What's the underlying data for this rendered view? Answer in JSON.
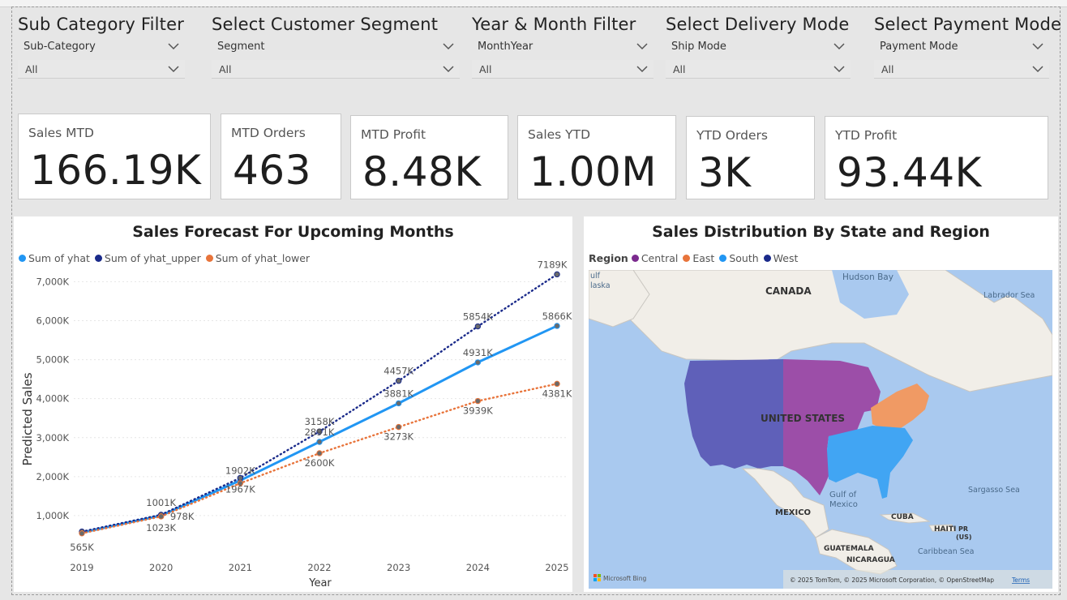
{
  "filters": [
    {
      "title": "Sub Category Filter",
      "field": "Sub-Category",
      "value": "All"
    },
    {
      "title": "Select Customer Segment",
      "field": "Segment",
      "value": "All"
    },
    {
      "title": "Year & Month Filter",
      "field": "MonthYear",
      "value": "All"
    },
    {
      "title": "Select Delivery Mode",
      "field": "Ship Mode",
      "value": "All"
    },
    {
      "title": "Select Payment Mode",
      "field": "Payment Mode",
      "value": "All"
    }
  ],
  "cards": [
    {
      "label": "Sales MTD",
      "value": "166.19K"
    },
    {
      "label": "MTD Orders",
      "value": "463"
    },
    {
      "label": "MTD Profit",
      "value": "8.48K"
    },
    {
      "label": "Sales YTD",
      "value": "1.00M"
    },
    {
      "label": "YTD Orders",
      "value": "3K"
    },
    {
      "label": "YTD Profit",
      "value": "93.44K"
    }
  ],
  "forecast": {
    "title": "Sales Forecast For Upcoming Months",
    "legend": [
      "Sum of yhat",
      "Sum of yhat_upper",
      "Sum of yhat_lower"
    ],
    "xlabel": "Year",
    "ylabel": "Predicted Sales"
  },
  "chart_data": {
    "type": "line",
    "title": "Sales Forecast For Upcoming Months",
    "xlabel": "Year",
    "ylabel": "Predicted Sales",
    "categories": [
      "2019",
      "2020",
      "2021",
      "2022",
      "2023",
      "2024",
      "2025"
    ],
    "ylim": [
      0,
      7300
    ],
    "yticks": [
      "1,000K",
      "2,000K",
      "3,000K",
      "4,000K",
      "5,000K",
      "6,000K",
      "7,000K"
    ],
    "grid": true,
    "legend_position": "top-left",
    "series": [
      {
        "name": "Sum of yhat",
        "color": "#2196f3",
        "style": "solid",
        "values": [
          565,
          1001,
          1902,
          2891,
          3881,
          4931,
          5866
        ],
        "labels": [
          "565K",
          "1001K",
          "1902K",
          "2891K",
          "3881K",
          "4931K",
          "5866K"
        ]
      },
      {
        "name": "Sum of yhat_upper",
        "color": "#1a2a8a",
        "style": "dotted",
        "values": [
          590,
          1023,
          1967,
          3158,
          4457,
          5854,
          7189
        ],
        "labels": [
          "",
          "1023K",
          "1967K",
          "3158K",
          "4457K",
          "5854K",
          "7189K"
        ]
      },
      {
        "name": "Sum of yhat_lower",
        "color": "#e8743b",
        "style": "dotted",
        "values": [
          545,
          978,
          1830,
          2600,
          3273,
          3939,
          4381
        ],
        "labels": [
          "",
          "978K",
          "",
          "2600K",
          "3273K",
          "3939K",
          "4381K"
        ]
      }
    ]
  },
  "map_panel": {
    "title": "Sales Distribution By State and Region",
    "legend_title": "Region",
    "regions": [
      {
        "name": "Central",
        "color": "#7b2a8e"
      },
      {
        "name": "East",
        "color": "#e8743b"
      },
      {
        "name": "South",
        "color": "#2196f3"
      },
      {
        "name": "West",
        "color": "#1a2a8a"
      }
    ],
    "labels": {
      "canada": "CANADA",
      "usa": "UNITED STATES",
      "mexico": "MEXICO",
      "cuba": "CUBA",
      "haiti": "HAITI",
      "pr": "PR",
      "us": "(US)",
      "guatemala": "GUATEMALA",
      "nicaragua": "NICARAGUA",
      "hudson": "Hudson Bay",
      "labrador": "Labrador Sea",
      "sargasso": "Sargasso Sea",
      "gulf1": "Gulf of",
      "gulf2": "Mexico",
      "caribbean": "Caribbean Sea",
      "alaska1": "ulf",
      "alaska2": "laska"
    },
    "bing": "Microsoft Bing",
    "attribution": "© 2025 TomTom, © 2025 Microsoft Corporation, © OpenStreetMap",
    "terms": "Terms"
  }
}
